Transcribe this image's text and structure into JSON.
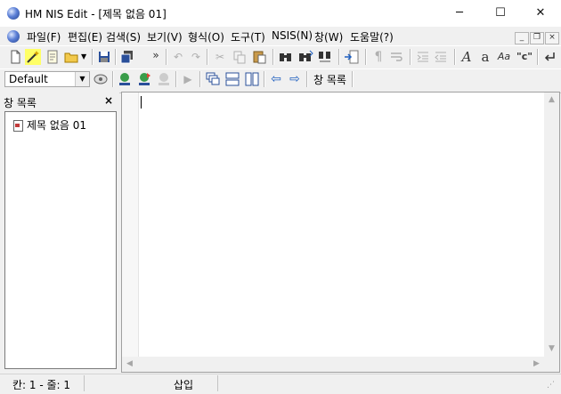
{
  "window": {
    "title": "HM NIS Edit - [제목 없음 01]",
    "minimize_glyph": "─",
    "maximize_glyph": "☐",
    "close_glyph": "✕"
  },
  "menu": {
    "items": [
      "파일(F)",
      "편집(E)",
      "검색(S)",
      "보기(V)",
      "형식(O)",
      "도구(T)",
      "NSIS(N)",
      "창(W)",
      "도움말(?)"
    ],
    "mdi_minimize": "_",
    "mdi_restore": "❐",
    "mdi_close": "×"
  },
  "toolbar": {
    "overflow": "»",
    "scheme_value": "Default",
    "window_list_label": "창 목록"
  },
  "panel": {
    "title": "창 목록",
    "close_glyph": "×",
    "items": [
      "제목 없음 01"
    ]
  },
  "status": {
    "position": "칸: 1 - 줄: 1",
    "mode": "삽입"
  },
  "icons": {
    "new": "new-file-icon",
    "wizard": "wizard-wand-icon",
    "template": "template-icon",
    "open": "open-folder-icon",
    "save": "save-icon",
    "save_all": "save-all-icon",
    "undo": "undo-icon",
    "redo": "redo-icon",
    "cut": "cut-icon",
    "copy": "copy-icon",
    "paste": "paste-icon",
    "find": "find-icon",
    "find_next": "find-next-icon",
    "replace": "replace-icon",
    "goto": "goto-line-icon",
    "pilcrow": "show-whitespace-icon",
    "wrap": "word-wrap-icon",
    "indent": "indent-icon",
    "outdent": "outdent-icon",
    "italic": "italic-icon",
    "lowercase": "lowercase-icon",
    "capitalize": "capitalize-icon",
    "quote": "quote-icon",
    "line_break": "line-break-icon"
  },
  "colors": {
    "accent_blue": "#1f5fbf",
    "title_bg": "#ffffff",
    "chrome_bg": "#f0f0f0"
  }
}
